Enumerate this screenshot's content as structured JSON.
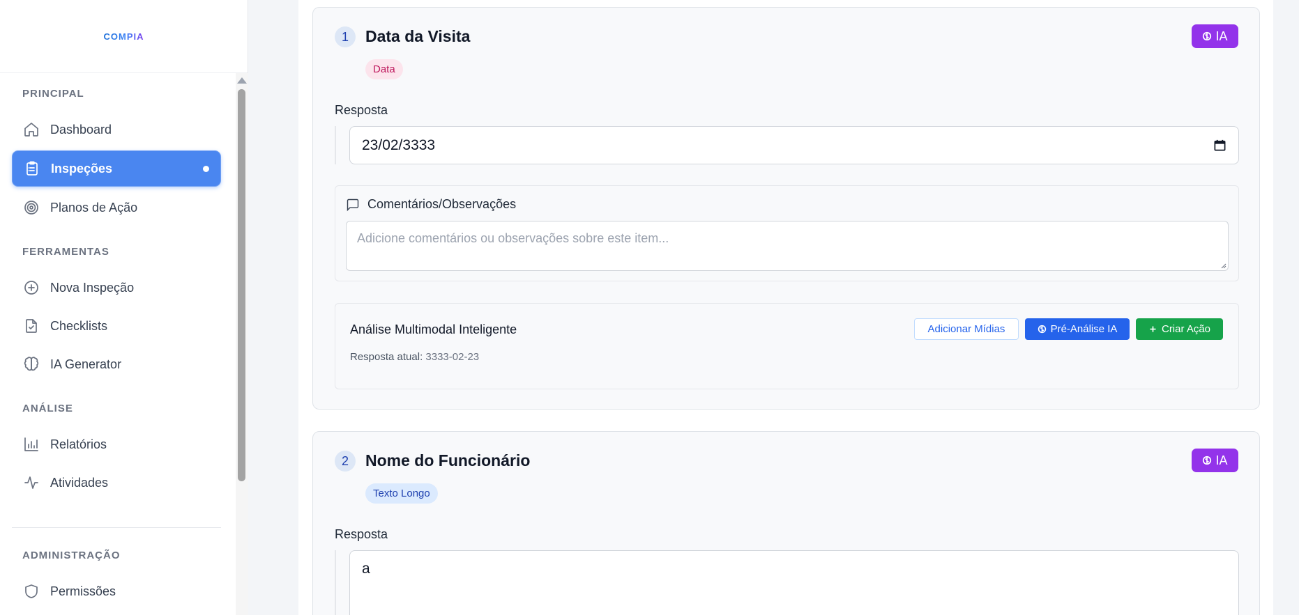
{
  "brand": {
    "logo_text": "COMPIA"
  },
  "sidebar": {
    "sections": [
      {
        "title": "PRINCIPAL"
      },
      {
        "title": "FERRAMENTAS"
      },
      {
        "title": "ANÁLISE"
      },
      {
        "title": "ADMINISTRAÇÃO"
      }
    ],
    "items": [
      {
        "label": "Dashboard",
        "icon": "home-icon",
        "active": false
      },
      {
        "label": "Inspeções",
        "icon": "clipboard-icon",
        "active": true
      },
      {
        "label": "Planos de Ação",
        "icon": "target-icon",
        "active": false
      },
      {
        "label": "Nova Inspeção",
        "icon": "plus-circle-icon",
        "active": false
      },
      {
        "label": "Checklists",
        "icon": "file-check-icon",
        "active": false
      },
      {
        "label": "IA Generator",
        "icon": "brain-icon",
        "active": false
      },
      {
        "label": "Relatórios",
        "icon": "bar-chart-icon",
        "active": false
      },
      {
        "label": "Atividades",
        "icon": "activity-icon",
        "active": false
      },
      {
        "label": "Permissões",
        "icon": "shield-icon",
        "active": false
      }
    ]
  },
  "items": [
    {
      "number": "1",
      "title": "Data da Visita",
      "type_label": "Data",
      "ai_label": "IA",
      "answer_label": "Resposta",
      "answer_value": "23/02/3333",
      "comments": {
        "label": "Comentários/Observações",
        "placeholder": "Adicione comentários ou observações sobre este item..."
      },
      "analysis": {
        "title": "Análise Multimodal Inteligente",
        "current_prefix": "Resposta atual:",
        "current_value": "3333-02-23",
        "add_media_label": "Adicionar Mídias",
        "pre_analysis_label": "Pré-Análise IA",
        "create_action_label": "Criar Ação"
      }
    },
    {
      "number": "2",
      "title": "Nome do Funcionário",
      "type_label": "Texto Longo",
      "ai_label": "IA",
      "answer_label": "Resposta",
      "answer_value": "a"
    }
  ],
  "colors": {
    "accent": "#4a86f0",
    "ai_purple": "#9333ea",
    "primary_blue": "#2563eb",
    "success_green": "#16a34a"
  }
}
